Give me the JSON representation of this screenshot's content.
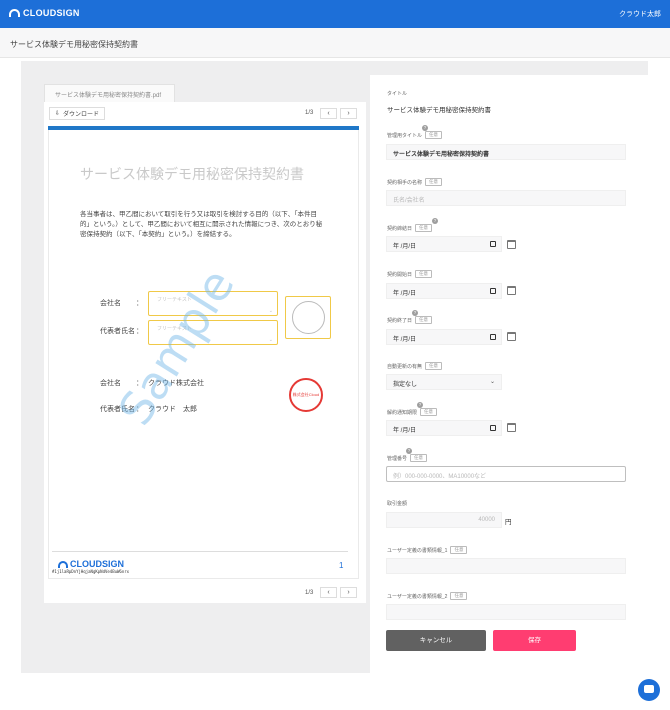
{
  "header": {
    "logo_text": "CLOUDSIGN",
    "user_name": "クラウド太郎"
  },
  "page": {
    "title": "サービス体験デモ用秘密保持契約書"
  },
  "viewer": {
    "file_tab": "サービス体験デモ用秘密保持契約書.pdf",
    "download_label": "ダウンロード",
    "page_indicator_top": "1/3",
    "page_indicator_bottom": "1/3",
    "prev": "‹",
    "next": "›",
    "doc": {
      "title": "サービス体験デモ用秘密保持契約書",
      "paragraph": "各当事者は、甲乙間において取引を行う又は取引を検討する目的（以下、「本件目的」という。）として、甲乙間において相互に開示された情報につき、次のとおり秘密保持契約（以下、「本契約」という。）を締結する。",
      "watermark": "Sample",
      "company_label_1": "会社名",
      "rep_label_1": "代表者氏名",
      "colon": "：",
      "free_text_ph": "フリーテキスト",
      "company_label_2": "会社名",
      "company_value_2": "クラウド株式会社",
      "rep_label_2": "代表者氏名",
      "rep_value_2": "クラウド　太郎",
      "red_seal_text": "株式会社Cloud",
      "footer_logo": "CLOUDSIGN",
      "footer_hash": "#1j1laRpDnYjHqjaNgKpNdVe4BuW6nrx",
      "page_number": "1"
    }
  },
  "form": {
    "optional_tag": "任意",
    "help_mark": "?",
    "title_label": "タイトル",
    "title_value": "サービス体験デモ用秘密保持契約書",
    "mgmt_title_label": "管理用タイトル",
    "mgmt_title_value": "サービス体験デモ用秘密保持契約書",
    "counterparty_label": "契約相手の名称",
    "counterparty_ph": "氏名/会社名",
    "contract_date_label": "契約締結日",
    "start_date_label": "契約開始日",
    "end_date_label": "契約終了日",
    "date_ph": "年 /月/日",
    "auto_renew_label": "自動更新の有無",
    "auto_renew_value": "指定なし",
    "notice_label": "解約通知期限",
    "mgmt_no_label": "管理番号",
    "mgmt_no_ph": "例）000-000-0000、MA10000など",
    "amount_label": "取引金額",
    "amount_ph": "40000",
    "yen": "円",
    "custom1_label": "ユーザー定義の書類情報_1",
    "custom2_label": "ユーザー定義の書類情報_2",
    "cancel": "キャンセル",
    "save": "保存"
  },
  "colors": {
    "brand": "#1d6fd8",
    "save": "#ff3d71",
    "cancel": "#616161",
    "seal": "#e53935"
  }
}
